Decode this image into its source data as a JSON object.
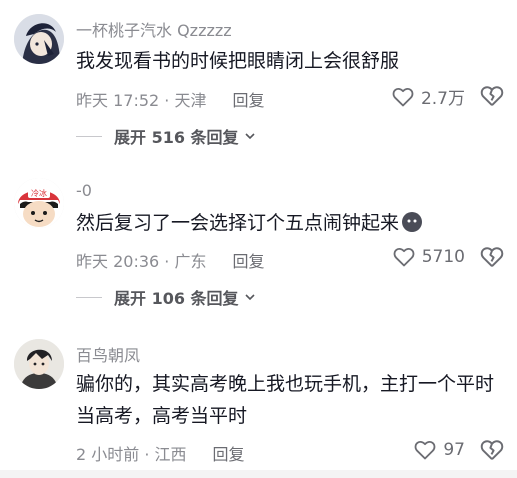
{
  "comments": [
    {
      "username": "一杯桃子汽水 Qzzzzz",
      "text": "我发现看书的时候把眼睛闭上会很舒服",
      "time": "昨天 17:52 · 天津",
      "reply_label": "回复",
      "likes": "2.7万",
      "expand_label": "展开 516 条回复"
    },
    {
      "username": "-0",
      "text": "然后复习了一会选择订个五点闹钟起来",
      "time": "昨天 20:36 · 广东",
      "reply_label": "回复",
      "likes": "5710",
      "expand_label": "展开 106 条回复",
      "avatar_badge": "冷冰"
    },
    {
      "username": "百鸟朝凤",
      "text": "骗你的，其实高考晚上我也玩手机，主打一个平时当高考，高考当平时",
      "time": "2 小时前 · 江西",
      "reply_label": "回复",
      "likes": "97"
    }
  ]
}
